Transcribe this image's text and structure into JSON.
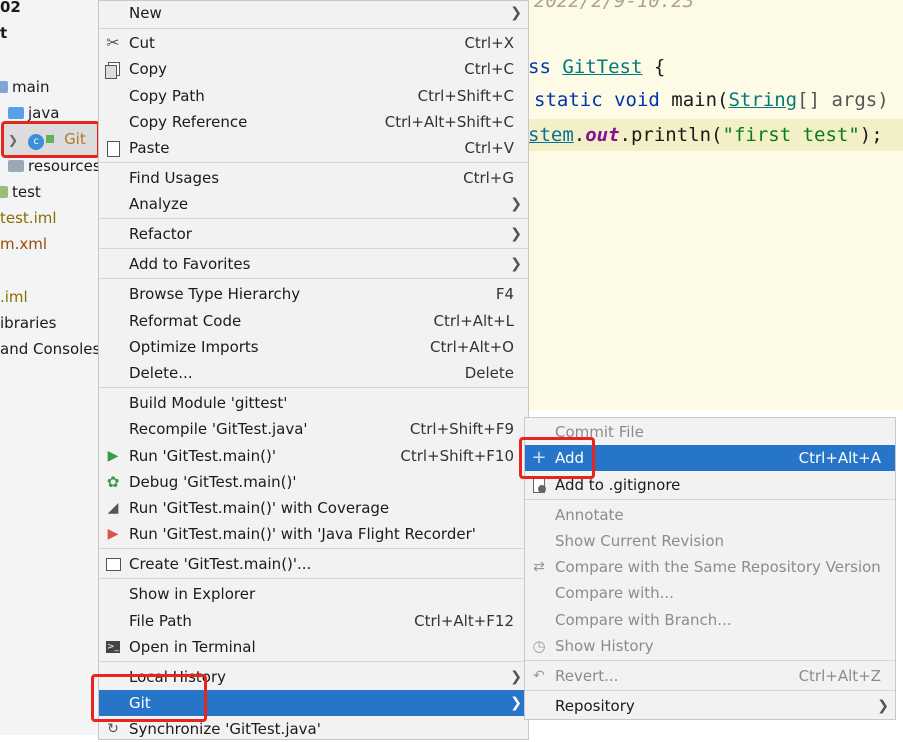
{
  "tree": {
    "partial_top": "02",
    "partial_t": "t",
    "main_label": "main",
    "java_label": "java",
    "file_label": "Git",
    "resources_label": "resources",
    "test_label": "test",
    "iml_label": "test.iml",
    "pom_label": "m.xml",
    "iml2_label": ".iml",
    "libraries_label": "ibraries",
    "consoles_label": "and Consoles"
  },
  "editor": {
    "line_date": "2022/2/9-10:23",
    "line_class_kw": "ss ",
    "line_class_name": "GitTest",
    "line_class_brace": " {",
    "line_main_kw": "static void ",
    "line_main_name": "main(",
    "line_main_type": "String",
    "line_main_args": "[] args)",
    "line_print_cls": "stem",
    "line_print_dot": ".",
    "line_print_out": "out",
    "line_print_call": ".println(",
    "line_print_str": "\"first test\"",
    "line_print_end": ");"
  },
  "context_menu": {
    "new": "New",
    "cut": "Cut",
    "cut_sc": "Ctrl+X",
    "copy": "Copy",
    "copy_sc": "Ctrl+C",
    "copy_path": "Copy Path",
    "copy_path_sc": "Ctrl+Shift+C",
    "copy_reference": "Copy Reference",
    "copy_reference_sc": "Ctrl+Alt+Shift+C",
    "paste": "Paste",
    "paste_sc": "Ctrl+V",
    "find_usages": "Find Usages",
    "find_usages_sc": "Ctrl+G",
    "analyze": "Analyze",
    "refactor": "Refactor",
    "add_to_favorites": "Add to Favorites",
    "browse_type_hierarchy": "Browse Type Hierarchy",
    "browse_type_hierarchy_sc": "F4",
    "reformat_code": "Reformat Code",
    "reformat_code_sc": "Ctrl+Alt+L",
    "optimize_imports": "Optimize Imports",
    "optimize_imports_sc": "Ctrl+Alt+O",
    "delete": "Delete...",
    "delete_sc": "Delete",
    "build_module": "Build Module 'gittest'",
    "recompile": "Recompile 'GitTest.java'",
    "recompile_sc": "Ctrl+Shift+F9",
    "run": "Run 'GitTest.main()'",
    "run_sc": "Ctrl+Shift+F10",
    "debug": "Debug 'GitTest.main()'",
    "run_coverage": "Run 'GitTest.main()' with Coverage",
    "run_jfr": "Run 'GitTest.main()' with 'Java Flight Recorder'",
    "create": "Create 'GitTest.main()'...",
    "show_in_explorer": "Show in Explorer",
    "file_path": "File Path",
    "file_path_sc": "Ctrl+Alt+F12",
    "open_in_terminal": "Open in Terminal",
    "local_history": "Local History",
    "git": "Git",
    "synchronize": "Synchronize 'GitTest.java'"
  },
  "git_submenu": {
    "commit_file": "Commit File",
    "add": "Add",
    "add_sc": "Ctrl+Alt+A",
    "add_gitignore": "Add to .gitignore",
    "annotate": "Annotate",
    "show_current_revision": "Show Current Revision",
    "compare_same_repo": "Compare with the Same Repository Version",
    "compare_with": "Compare with...",
    "compare_with_branch": "Compare with Branch...",
    "show_history": "Show History",
    "revert": "Revert...",
    "revert_sc": "Ctrl+Alt+Z",
    "repository": "Repository"
  },
  "colors": {
    "highlight": "#2775c8",
    "annotation_red": "#e8251d",
    "run_green": "#3a9a4a"
  }
}
